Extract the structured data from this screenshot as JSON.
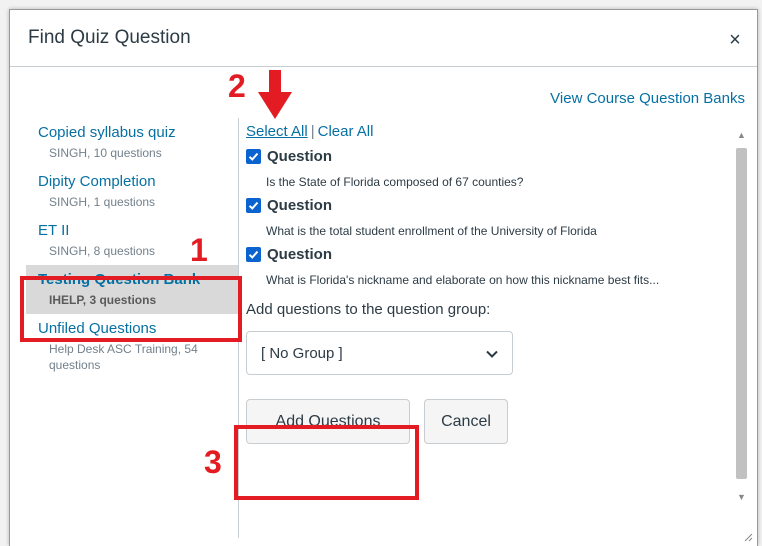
{
  "dialog": {
    "title": "Find Quiz Question",
    "close_glyph": "×",
    "view_banks_link": "View Course Question Banks"
  },
  "banks": [
    {
      "name": "Copied syllabus quiz",
      "meta": "SINGH, 10 questions"
    },
    {
      "name": "Dipity Completion",
      "meta": "SINGH, 1 questions"
    },
    {
      "name": "ET II",
      "meta": "SINGH, 8 questions"
    },
    {
      "name": "Testing Question Bank",
      "meta": "IHELP, 3 questions",
      "selected": true
    },
    {
      "name": "Unfiled Questions",
      "meta": "Help Desk ASC Training, 54 questions"
    }
  ],
  "selection": {
    "select_all": "Select All",
    "separator": "|",
    "clear_all": "Clear All"
  },
  "questions": [
    {
      "label": "Question",
      "text": "Is the State of Florida composed of 67 counties?",
      "checked": true
    },
    {
      "label": "Question",
      "text": "What is the total student enrollment of the University of Florida",
      "checked": true
    },
    {
      "label": "Question",
      "text": "What is Florida's nickname and elaborate on how this nickname best fits...",
      "checked": true
    }
  ],
  "group": {
    "label": "Add questions to the question group:",
    "selected": "[ No Group ]"
  },
  "buttons": {
    "add": "Add Questions",
    "cancel": "Cancel"
  },
  "annotations": {
    "step1": "1",
    "step2": "2",
    "step3": "3"
  },
  "colors": {
    "link": "#0770a3",
    "checkbox": "#0a63cf",
    "annotation": "#e31b23",
    "selected_bg": "#d9d9d9"
  },
  "icons": {
    "close": "close-icon",
    "dropdown": "chevron-down-icon",
    "checkbox": "checkbox-checked-icon",
    "arrow": "arrow-down-icon",
    "resize": "resize-handle-icon"
  }
}
